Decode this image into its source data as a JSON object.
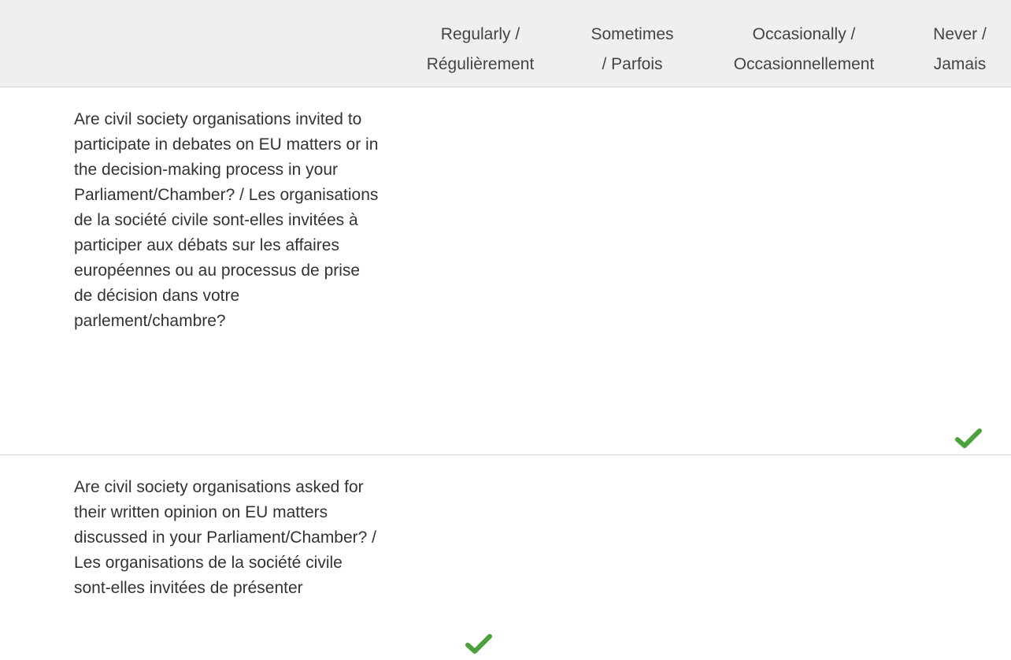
{
  "columns": [
    {
      "line1": "Regularly /",
      "line2": "Régulièrement"
    },
    {
      "line1": "Sometimes",
      "line2": "/ Parfois"
    },
    {
      "line1": "Occasionally /",
      "line2": "Occasionnellement"
    },
    {
      "line1": "Never /",
      "line2": "Jamais"
    }
  ],
  "rows": [
    {
      "question": "Are civil society organisations invited to participate in debates on EU matters or in the decision-making process in your Parliament/Chamber? / Les organisations de la société civile sont-elles invitées à participer aux débats sur les affaires européennes ou au processus de prise de décision dans votre parlement/chambre?",
      "selected_column": "Never / Jamais"
    },
    {
      "question": "Are civil society organisations asked for their written opinion on EU matters discussed in your Parliament/Chamber? / Les organisations de la société civile sont-elles invitées de présenter",
      "selected_column": "Regularly / Régulièrement"
    }
  ],
  "colors": {
    "header_bg": "#efefef",
    "check_green": "#4aa23a",
    "divider": "#d4d4d4"
  },
  "icons": {
    "selected": "check-icon"
  }
}
